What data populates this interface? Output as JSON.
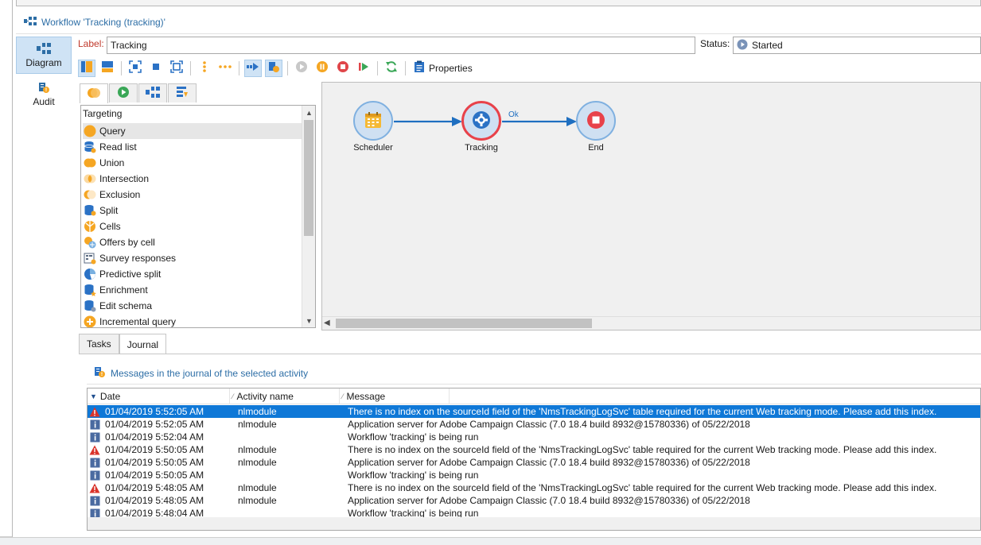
{
  "window": {
    "title": "Workflow 'Tracking (tracking)'"
  },
  "nav": {
    "items": [
      {
        "label": "Diagram",
        "icon": "workflow-diagram-icon",
        "selected": true
      },
      {
        "label": "Audit",
        "icon": "audit-icon",
        "selected": false
      }
    ]
  },
  "form": {
    "label_caption": "Label:",
    "label_value": "Tracking",
    "status_caption": "Status:",
    "status_value": "Started"
  },
  "toolbar": {
    "properties_label": "Properties"
  },
  "palette": {
    "tabs": [
      "targeting-tab",
      "flow-control-tab",
      "actions-tab",
      "events-tab"
    ],
    "header": "Targeting",
    "items": [
      {
        "label": "Query",
        "icon": "query-icon",
        "selected": true
      },
      {
        "label": "Read list",
        "icon": "read-list-icon"
      },
      {
        "label": "Union",
        "icon": "union-icon"
      },
      {
        "label": "Intersection",
        "icon": "intersection-icon"
      },
      {
        "label": "Exclusion",
        "icon": "exclusion-icon"
      },
      {
        "label": "Split",
        "icon": "split-icon"
      },
      {
        "label": "Cells",
        "icon": "cells-icon"
      },
      {
        "label": "Offers by cell",
        "icon": "offers-by-cell-icon"
      },
      {
        "label": "Survey responses",
        "icon": "survey-responses-icon"
      },
      {
        "label": "Predictive split",
        "icon": "predictive-split-icon"
      },
      {
        "label": "Enrichment",
        "icon": "enrichment-icon"
      },
      {
        "label": "Edit schema",
        "icon": "edit-schema-icon"
      },
      {
        "label": "Incremental query",
        "icon": "incremental-query-icon"
      }
    ]
  },
  "diagram": {
    "nodes": [
      {
        "label": "Scheduler",
        "icon": "calendar-icon"
      },
      {
        "label": "Tracking",
        "icon": "gear-icon"
      },
      {
        "label": "End",
        "icon": "stop-icon"
      }
    ],
    "transition_label": "Ok"
  },
  "bottom_tabs": [
    "Tasks",
    "Journal"
  ],
  "journal": {
    "title": "Messages in the journal of the selected activity",
    "columns": [
      "Date",
      "Activity name",
      "Message"
    ],
    "rows": [
      {
        "type": "warning",
        "date": "01/04/2019 5:52:05 AM",
        "activity": "nlmodule",
        "message": "There is no index on the sourceId field of the 'NmsTrackingLogSvc' table required for the current Web tracking mode. Please add this index.",
        "selected": true
      },
      {
        "type": "info",
        "date": "01/04/2019 5:52:05 AM",
        "activity": "nlmodule",
        "message": "Application server for Adobe Campaign Classic (7.0 18.4 build 8932@15780336) of 05/22/2018"
      },
      {
        "type": "info",
        "date": "01/04/2019 5:52:04 AM",
        "activity": "",
        "message": "Workflow 'tracking' is being run"
      },
      {
        "type": "warning",
        "date": "01/04/2019 5:50:05 AM",
        "activity": "nlmodule",
        "message": "There is no index on the sourceId field of the 'NmsTrackingLogSvc' table required for the current Web tracking mode. Please add this index."
      },
      {
        "type": "info",
        "date": "01/04/2019 5:50:05 AM",
        "activity": "nlmodule",
        "message": "Application server for Adobe Campaign Classic (7.0 18.4 build 8932@15780336) of 05/22/2018"
      },
      {
        "type": "info",
        "date": "01/04/2019 5:50:05 AM",
        "activity": "",
        "message": "Workflow 'tracking' is being run"
      },
      {
        "type": "warning",
        "date": "01/04/2019 5:48:05 AM",
        "activity": "nlmodule",
        "message": "There is no index on the sourceId field of the 'NmsTrackingLogSvc' table required for the current Web tracking mode. Please add this index."
      },
      {
        "type": "info",
        "date": "01/04/2019 5:48:05 AM",
        "activity": "nlmodule",
        "message": "Application server for Adobe Campaign Classic (7.0 18.4 build 8932@15780336) of 05/22/2018"
      },
      {
        "type": "info",
        "date": "01/04/2019 5:48:04 AM",
        "activity": "",
        "message": "Workflow 'tracking' is being run"
      }
    ]
  },
  "colors": {
    "accent": "#2d6ea6",
    "selection": "#0f78d7",
    "warning": "#d9332b",
    "info": "#4a6aa0"
  }
}
